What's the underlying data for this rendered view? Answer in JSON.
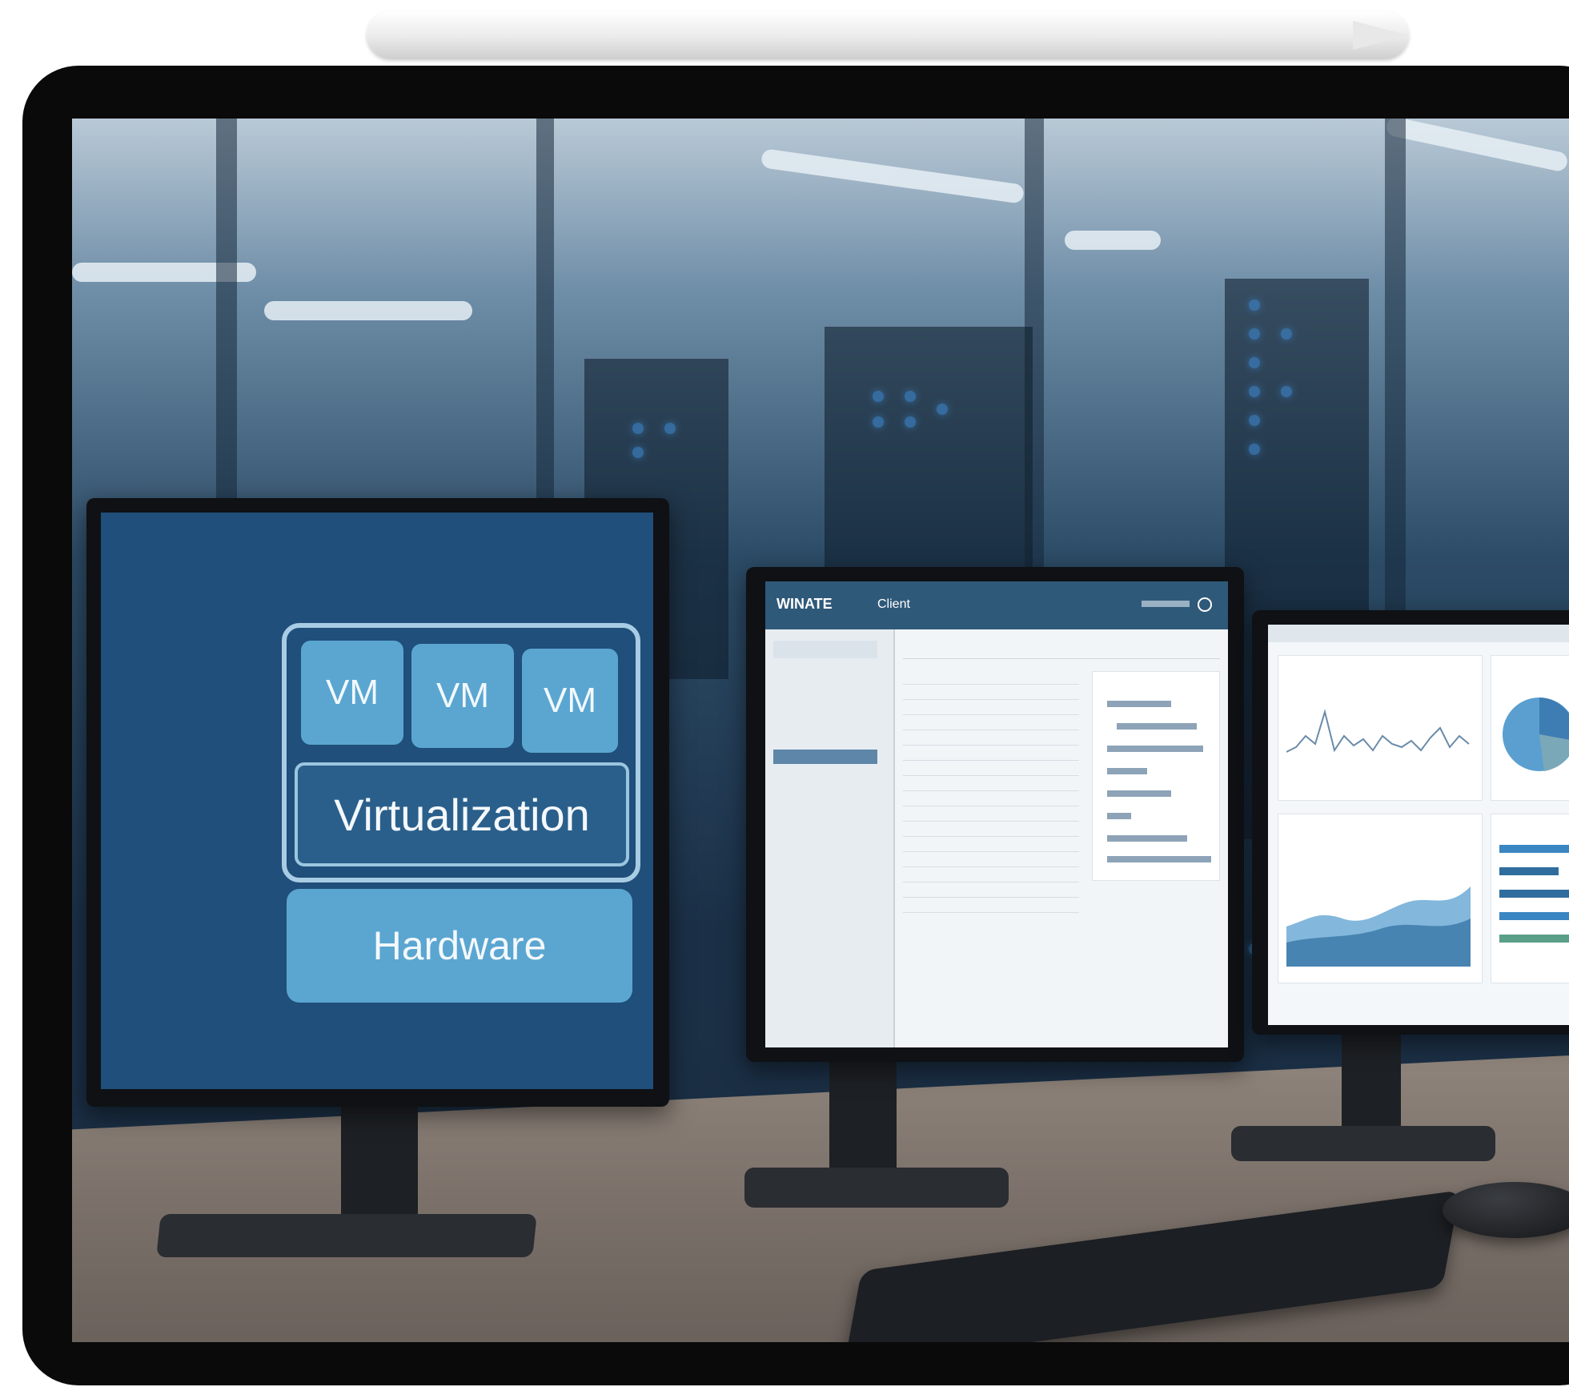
{
  "left_monitor": {
    "vm_labels": [
      "VM",
      "VM",
      "VM"
    ],
    "virtualization_label": "Virtualization",
    "hardware_label": "Hardware"
  },
  "middle_monitor": {
    "header_title": "WINATE",
    "header_subtitle": "Client"
  },
  "colors": {
    "accent_blue": "#5aa6d1",
    "panel_blue": "#1f4f7a",
    "dark_blue": "#2a5f8b"
  }
}
